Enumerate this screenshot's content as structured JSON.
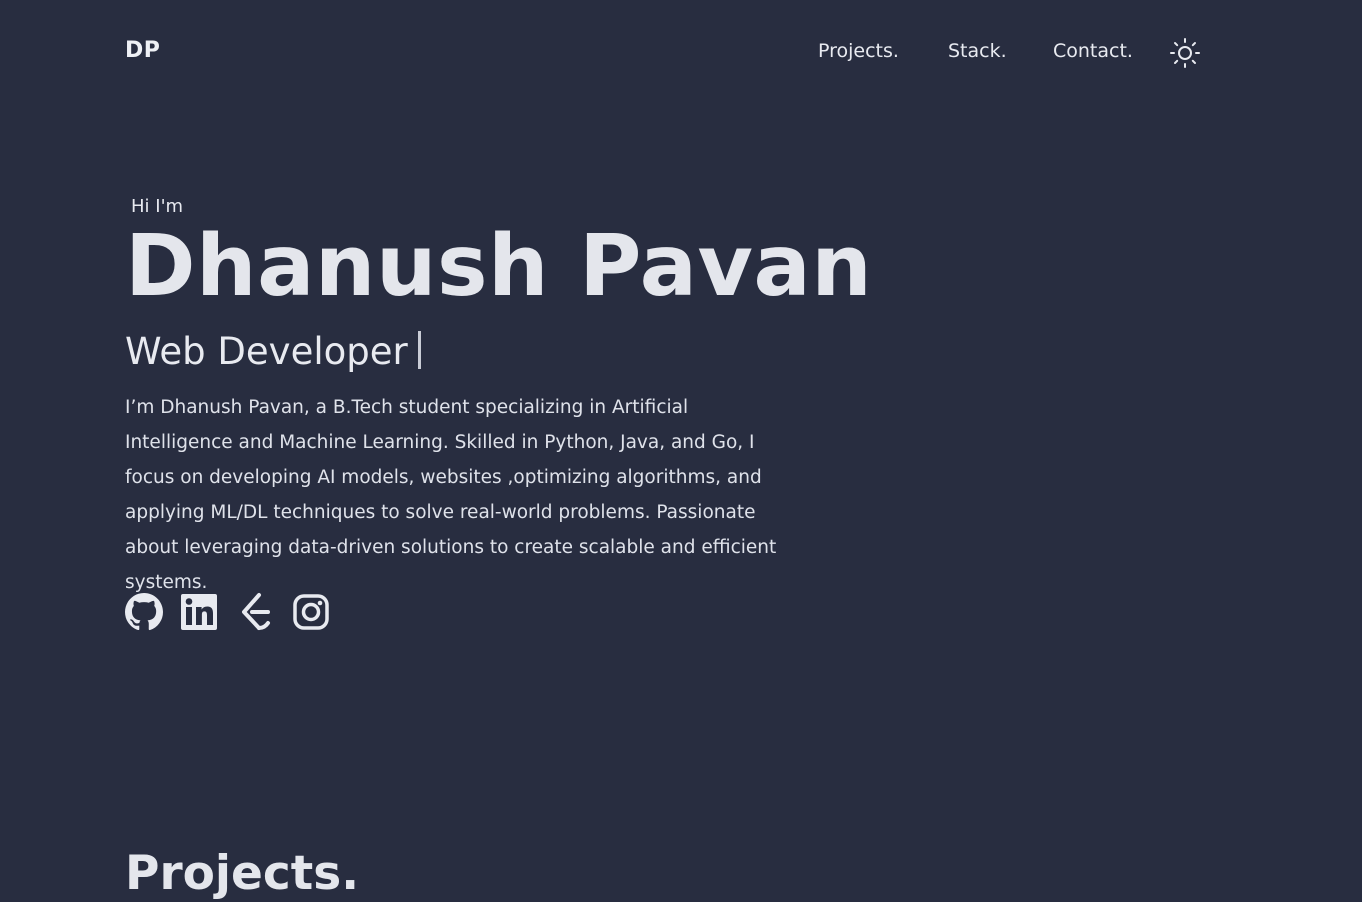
{
  "header": {
    "logo": "DP",
    "nav": [
      {
        "label": "Projects."
      },
      {
        "label": "Stack."
      },
      {
        "label": "Contact."
      }
    ],
    "theme_icon": "sun-icon"
  },
  "hero": {
    "greeting": "Hi I'm",
    "name": "Dhanush Pavan",
    "role": "Web Developer",
    "bio": "I’m Dhanush Pavan, a B.Tech student specializing in Artificial Intelligence and Machine Learning. Skilled in Python, Java, and Go, I focus on developing AI models, websites ,optimizing algorithms, and applying ML/DL techniques to solve real-world problems. Passionate about leveraging data-driven solutions to create scalable and efficient systems."
  },
  "socials": [
    {
      "icon": "github-icon"
    },
    {
      "icon": "linkedin-icon"
    },
    {
      "icon": "leetcode-icon"
    },
    {
      "icon": "instagram-icon"
    }
  ],
  "sections": {
    "projects_title": "Projects."
  },
  "colors": {
    "background": "#282d40",
    "text": "#e6e8ee"
  }
}
